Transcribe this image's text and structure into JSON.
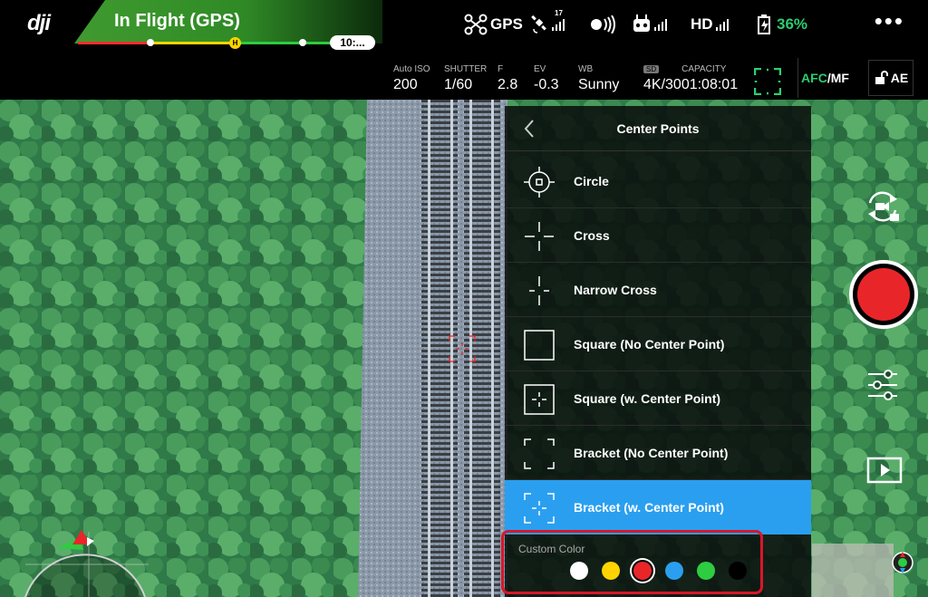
{
  "status": {
    "flight_mode": "In Flight (GPS)",
    "flight_time": "10:...",
    "home_marker": "H",
    "gps_label": "GPS",
    "satellite_count": "17",
    "hd_label": "HD",
    "battery_percent": "36%"
  },
  "camera": {
    "iso_label": "Auto ISO",
    "iso_value": "200",
    "shutter_label": "SHUTTER",
    "shutter_value": "1/60",
    "f_label": "F",
    "f_value": "2.8",
    "ev_label": "EV",
    "ev_value": "-0.3",
    "wb_label": "WB",
    "wb_value": "Sunny",
    "sd_badge": "SD",
    "capacity_label": "CAPACITY",
    "resolution_value": "4K/30",
    "capacity_value": "01:08:01",
    "afc_label": "AFC",
    "mf_label": "/MF",
    "ae_label": "AE"
  },
  "panel": {
    "title": "Center Points",
    "options": [
      {
        "label": "Circle"
      },
      {
        "label": "Cross"
      },
      {
        "label": "Narrow Cross"
      },
      {
        "label": "Square (No Center Point)"
      },
      {
        "label": "Square (w. Center Point)"
      },
      {
        "label": "Bracket (No Center Point)"
      },
      {
        "label": "Bracket (w. Center Point)",
        "selected": true
      }
    ],
    "custom_color_label": "Custom Color",
    "colors": [
      "#ffffff",
      "#ffd400",
      "#e8262a",
      "#2a9ff0",
      "#2ecc40",
      "#000000"
    ],
    "selected_color": "#e8262a"
  },
  "accent_colors": {
    "status_green": "#3f9b2f",
    "selection_blue": "#2a9ff0",
    "record_red": "#e8262a",
    "battery_green": "#2ecc71"
  }
}
